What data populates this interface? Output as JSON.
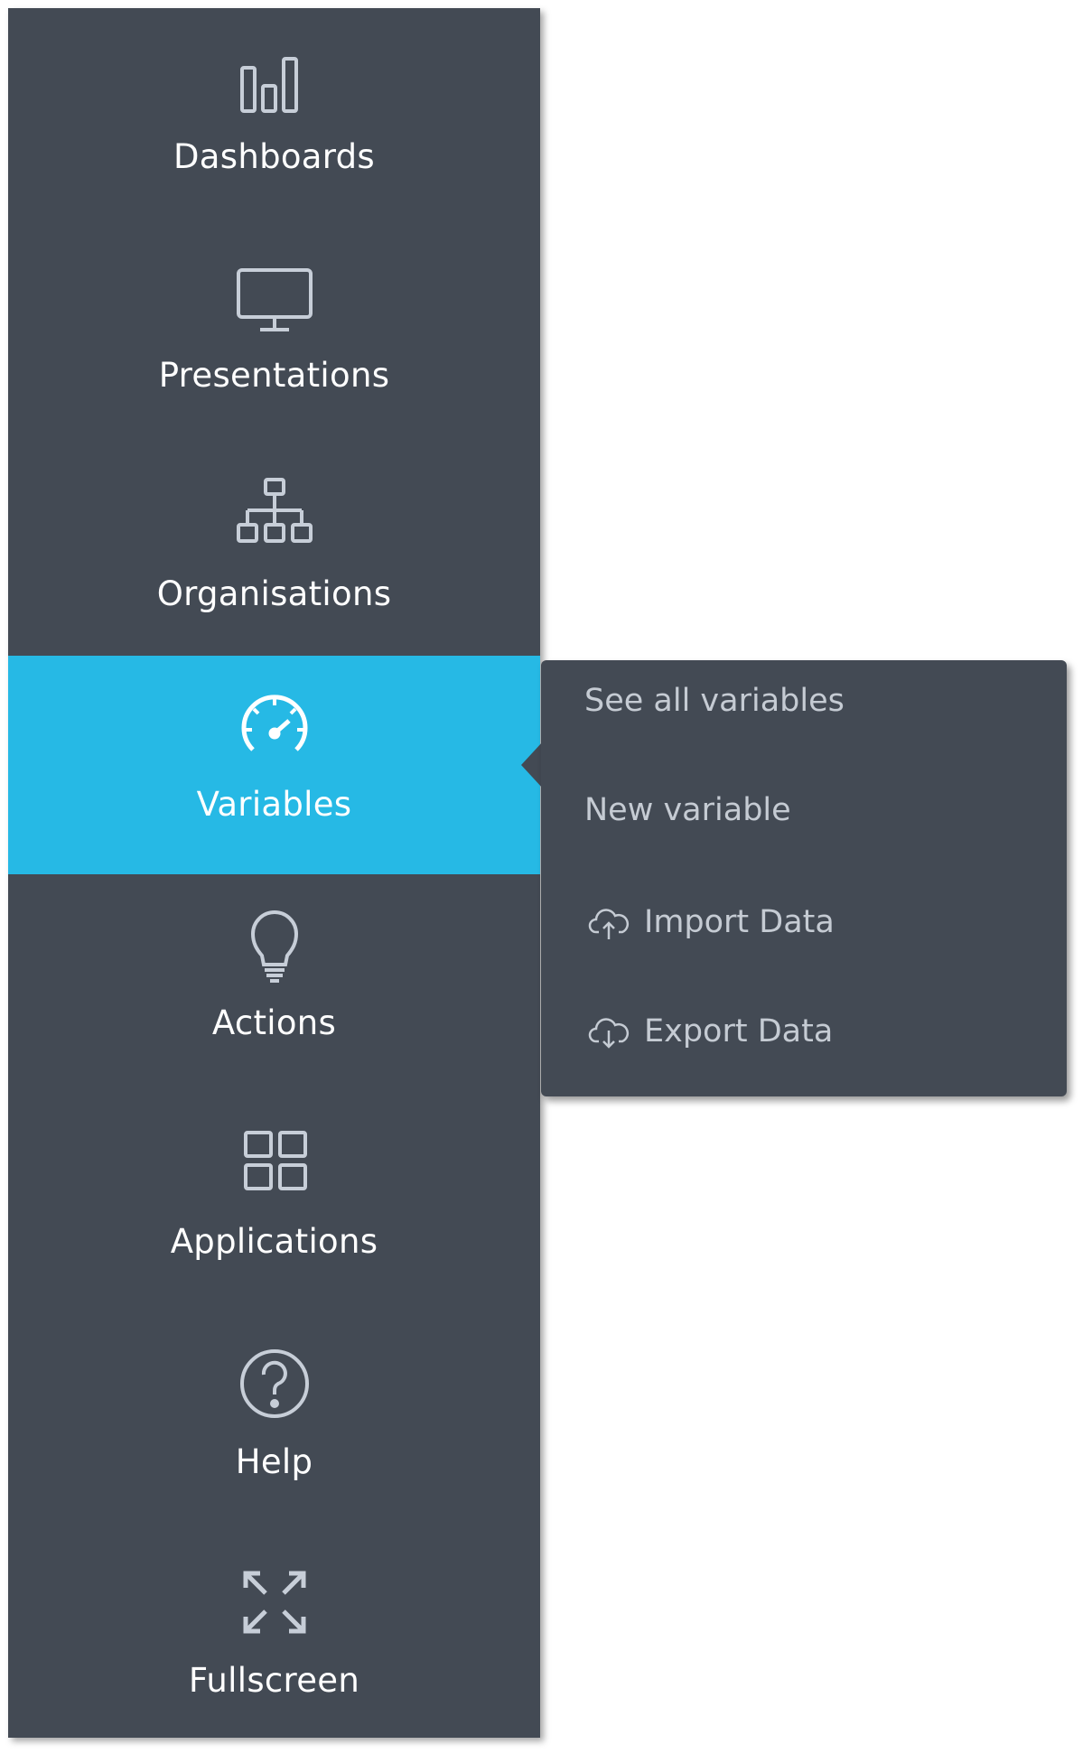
{
  "sidebar": {
    "items": [
      {
        "label": "Dashboards",
        "icon": "bar-chart-icon",
        "active": false
      },
      {
        "label": "Presentations",
        "icon": "monitor-icon",
        "active": false
      },
      {
        "label": "Organisations",
        "icon": "org-chart-icon",
        "active": false
      },
      {
        "label": "Variables",
        "icon": "speedometer-icon",
        "active": true
      },
      {
        "label": "Actions",
        "icon": "lightbulb-icon",
        "active": false
      },
      {
        "label": "Applications",
        "icon": "grid-icon",
        "active": false
      },
      {
        "label": "Help",
        "icon": "question-circle-icon",
        "active": false
      },
      {
        "label": "Fullscreen",
        "icon": "expand-arrows-icon",
        "active": false
      }
    ]
  },
  "submenu": {
    "items": [
      {
        "label": "See all variables"
      },
      {
        "label": "New variable"
      },
      {
        "label": "Import Data",
        "icon": "cloud-upload-icon"
      },
      {
        "label": "Export Data",
        "icon": "cloud-download-icon"
      }
    ]
  },
  "colors": {
    "sidebar_bg": "#434a54",
    "active_bg": "#26b9e5",
    "icon_stroke": "#c7ced8",
    "submenu_text": "#c5cbd3"
  }
}
